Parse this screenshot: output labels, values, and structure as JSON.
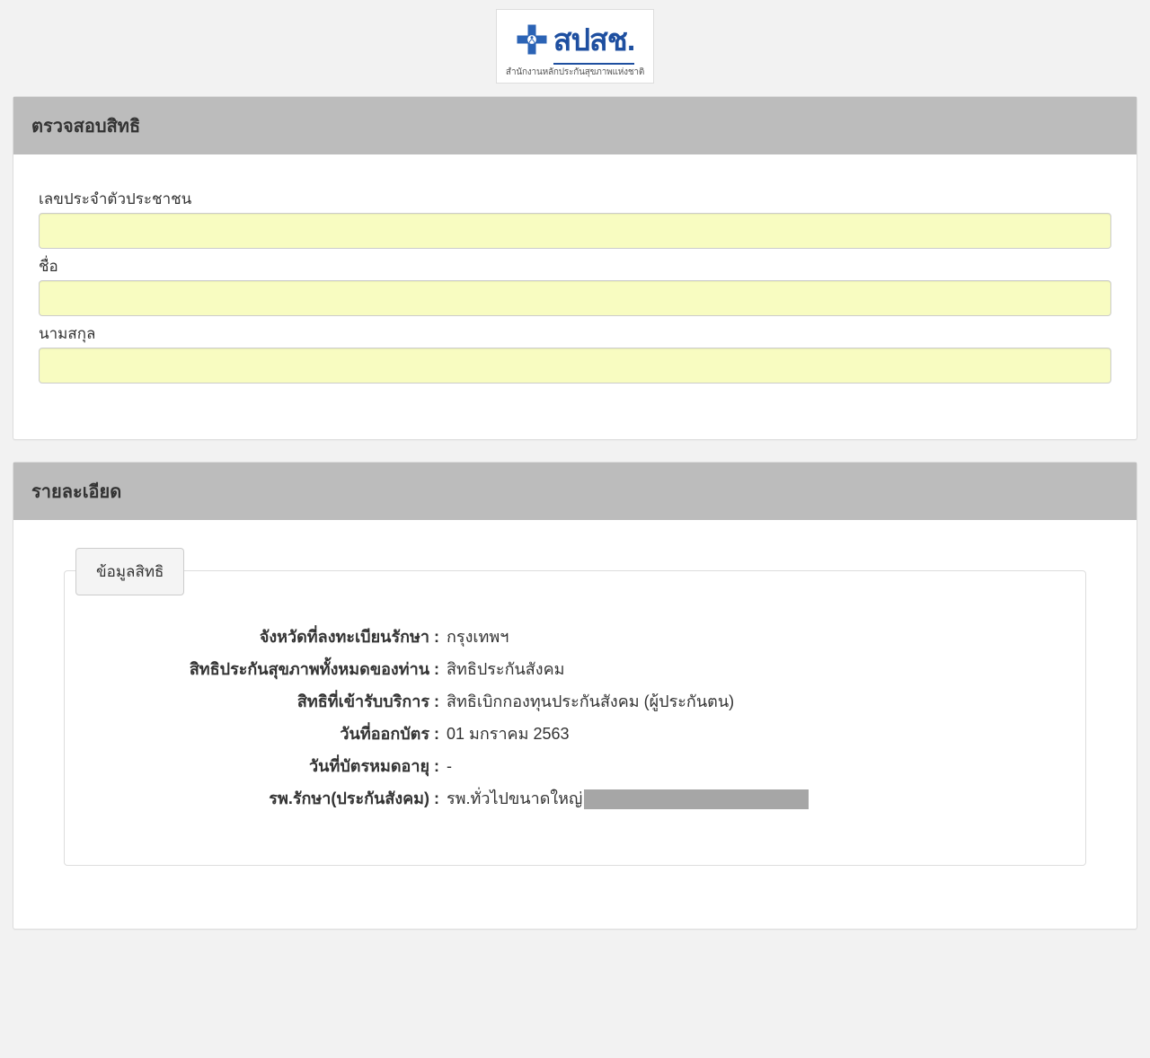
{
  "logo": {
    "title": "สปสช.",
    "subtitle": "สำนักงานหลักประกันสุขภาพแห่งชาติ"
  },
  "checkPanel": {
    "title": "ตรวจสอบสิทธิ",
    "fields": {
      "citizenId": {
        "label": "เลขประจำตัวประชาชน",
        "value": ""
      },
      "firstName": {
        "label": "ชื่อ",
        "value": ""
      },
      "lastName": {
        "label": "นามสกุล",
        "value": ""
      }
    }
  },
  "detailsPanel": {
    "title": "รายละเอียด",
    "fieldsetTitle": "ข้อมูลสิทธิ",
    "rows": {
      "province": {
        "label": "จังหวัดที่ลงทะเบียนรักษา :",
        "value": "กรุงเทพฯ"
      },
      "healthRights": {
        "label": "สิทธิประกันสุขภาพทั้งหมดของท่าน :",
        "value": "สิทธิประกันสังคม"
      },
      "serviceRights": {
        "label": "สิทธิที่เข้ารับบริการ :",
        "value": "สิทธิเบิกกองทุนประกันสังคม (ผู้ประกันตน)"
      },
      "issueDate": {
        "label": "วันที่ออกบัตร :",
        "value": "01 มกราคม 2563"
      },
      "expireDate": {
        "label": "วันที่บัตรหมดอายุ :",
        "value": "-"
      },
      "hospital": {
        "label": "รพ.รักษา(ประกันสังคม) :",
        "value": "รพ.ทั่วไปขนาดใหญ่"
      }
    }
  }
}
